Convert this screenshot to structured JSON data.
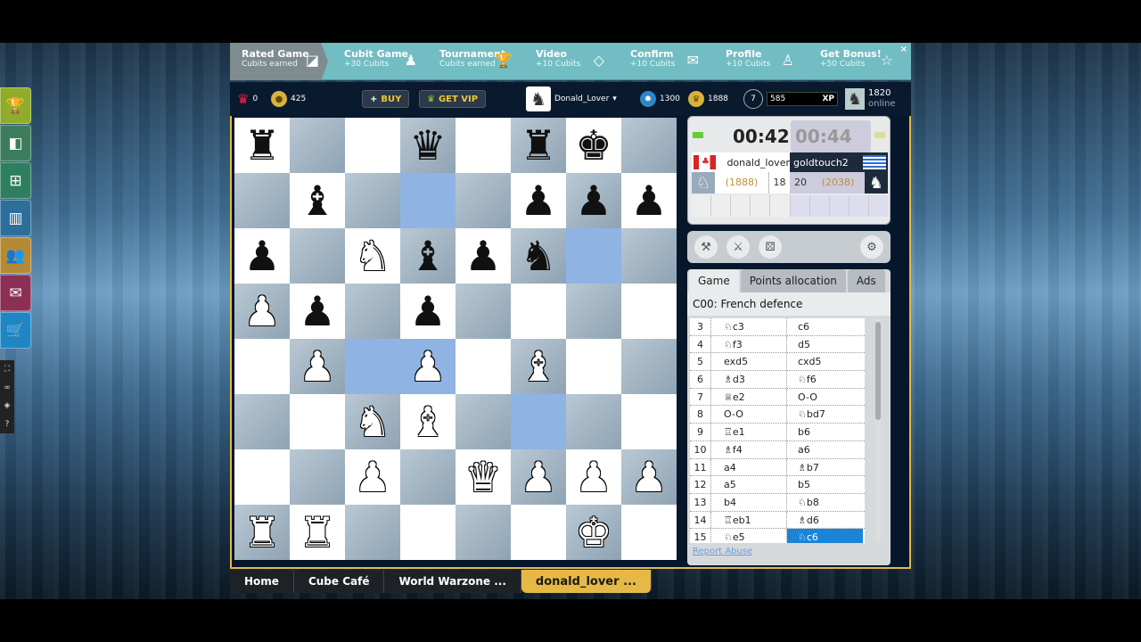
{
  "topbar": {
    "items": [
      {
        "title": "Rated Game",
        "sub": "Cubits earned"
      },
      {
        "title": "Cubit Game",
        "sub": "+30 Cubits"
      },
      {
        "title": "Tournament",
        "sub": "Cubits earned"
      },
      {
        "title": "Video",
        "sub": "+10 Cubits"
      },
      {
        "title": "Confirm",
        "sub": "+10 Cubits"
      },
      {
        "title": "Profile",
        "sub": "+10 Cubits"
      },
      {
        "title": "Get Bonus!",
        "sub": "+50 Cubits"
      }
    ],
    "close": "×"
  },
  "stats": {
    "crowns": "0",
    "coins": "425",
    "buy": "BUY",
    "vip": "GET VIP",
    "username": "Donald_Lover",
    "cubes": "1300",
    "rating": "1888",
    "level": "7",
    "xp_value": "585",
    "xp_label": "XP",
    "online_count": "1820",
    "online_label": "online"
  },
  "clock": {
    "white_time": "00:42",
    "black_time": "00:44",
    "white_name": "donald_lover",
    "black_name": "goldtouch2",
    "white_rating": "(1888)",
    "white_n": "18",
    "black_n": "20",
    "black_rating": "(2038)"
  },
  "panel": {
    "tabs": [
      "Game",
      "Points allocation",
      "Ads"
    ],
    "opening": "C00: French defence",
    "moves": [
      {
        "n": "3",
        "w": "♘c3",
        "b": "c6"
      },
      {
        "n": "4",
        "w": "♘f3",
        "b": "d5"
      },
      {
        "n": "5",
        "w": "exd5",
        "b": "cxd5"
      },
      {
        "n": "6",
        "w": "♗d3",
        "b": "♘f6"
      },
      {
        "n": "7",
        "w": "♕e2",
        "b": "O-O"
      },
      {
        "n": "8",
        "w": "O-O",
        "b": "♘bd7"
      },
      {
        "n": "9",
        "w": "♖e1",
        "b": "b6"
      },
      {
        "n": "10",
        "w": "♗f4",
        "b": "a6"
      },
      {
        "n": "11",
        "w": "a4",
        "b": "♗b7"
      },
      {
        "n": "12",
        "w": "a5",
        "b": "b5"
      },
      {
        "n": "13",
        "w": "b4",
        "b": "♘b8"
      },
      {
        "n": "14",
        "w": "♖eb1",
        "b": "♗d6"
      },
      {
        "n": "15",
        "w": "♘e5",
        "b": "♘c6"
      }
    ],
    "report": "Report Abuse"
  },
  "board": [
    [
      "br",
      "",
      "",
      "bq",
      "",
      "br",
      "bk",
      ""
    ],
    [
      "",
      "bb",
      "",
      "",
      "",
      "bp",
      "bp",
      "bp"
    ],
    [
      "bp",
      "",
      "wn",
      "bb",
      "bp",
      "bn",
      "",
      ""
    ],
    [
      "wp",
      "bp",
      "",
      "bp",
      "",
      "",
      "",
      ""
    ],
    [
      "",
      "wp",
      "",
      "wp",
      "",
      "wb",
      "",
      ""
    ],
    [
      "",
      "",
      "wn",
      "wb",
      "",
      "",
      "",
      ""
    ],
    [
      "",
      "",
      "wp",
      "",
      "wq",
      "wp",
      "wp",
      "wp"
    ],
    [
      "wr",
      "wr",
      "",
      "",
      "",
      "",
      "wk",
      ""
    ]
  ],
  "highlights": [
    "d7",
    "g6",
    "c4",
    "f3",
    "d4"
  ],
  "glyphs": {
    "k": "♚",
    "q": "♛",
    "r": "♜",
    "b": "♝",
    "n": "♞",
    "p": "♟"
  },
  "bottom_tabs": [
    "Home",
    "Cube Café",
    "World Warzone ...",
    "donald_lover ..."
  ],
  "sidebar_icons": [
    "trophy-icon",
    "puzzle-icon",
    "board-icon",
    "stats-icon",
    "friends-icon",
    "chat-icon",
    "cart-icon"
  ],
  "colors": {
    "accent_gold": "#e6b947",
    "topbar_teal": "#72bdc3",
    "highlight": "#8fb3e3",
    "selected_move": "#1b84d7"
  }
}
